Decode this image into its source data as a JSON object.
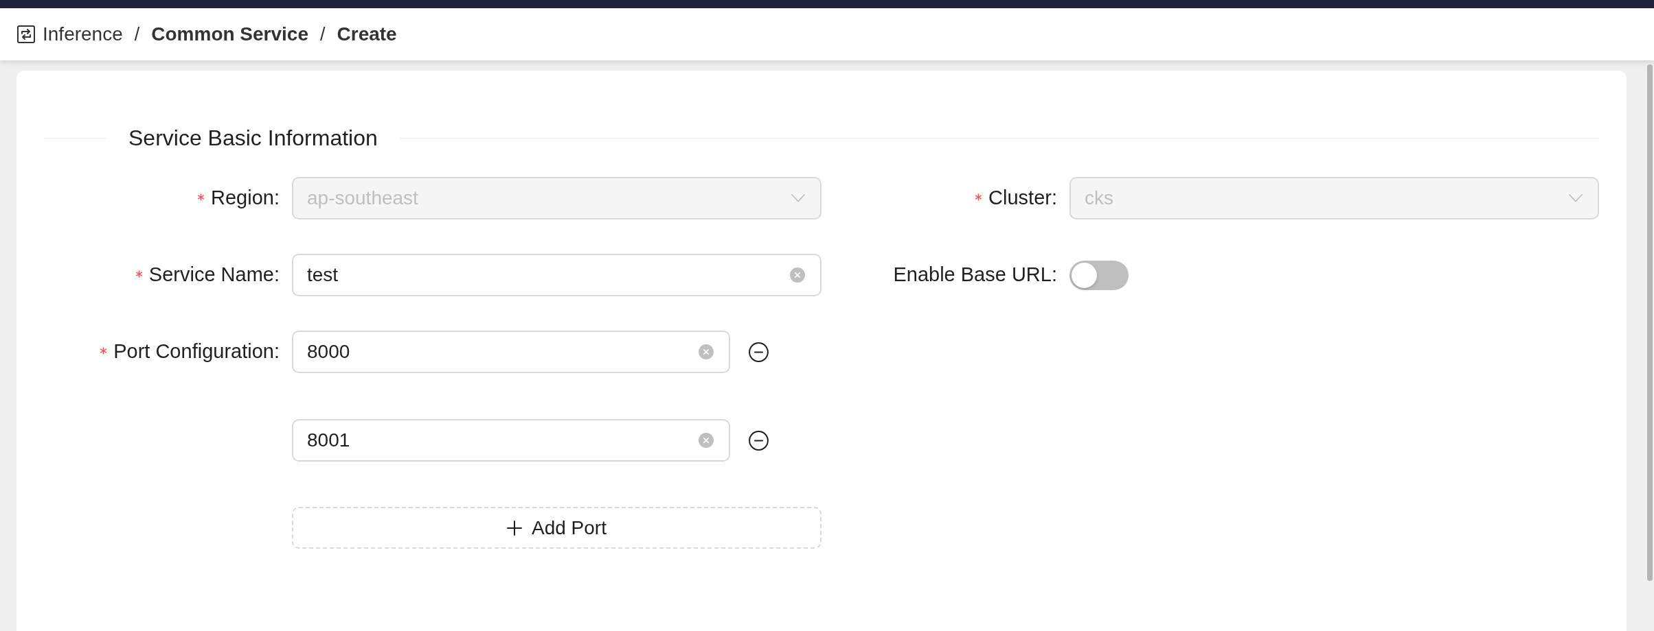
{
  "breadcrumb": {
    "items": [
      {
        "label": "Inference",
        "kind": "module"
      },
      {
        "label": "Common Service",
        "kind": "page"
      },
      {
        "label": "Create",
        "kind": "page"
      }
    ],
    "separators": [
      "/",
      "/"
    ]
  },
  "section": {
    "title": "Service Basic Information",
    "rows": [
      {
        "fields": [
          {
            "kind": "select",
            "label": "Region:",
            "required": true,
            "disabled": true,
            "value": "ap-southeast"
          },
          {
            "kind": "select",
            "label": "Cluster:",
            "required": true,
            "disabled": true,
            "value": "cks"
          }
        ]
      },
      {
        "fields": [
          {
            "kind": "text",
            "label": "Service Name:",
            "required": true,
            "disabled": false,
            "value": "test"
          },
          {
            "kind": "switch",
            "label": "Enable Base URL:",
            "required": false,
            "on": false
          }
        ]
      },
      {
        "fields": [
          {
            "kind": "port_list",
            "label": "Port Configuration:",
            "required": true,
            "ports": [
              {
                "value": "8000"
              },
              {
                "value": "8001"
              }
            ],
            "add_button": "Add Port"
          }
        ]
      }
    ]
  }
}
